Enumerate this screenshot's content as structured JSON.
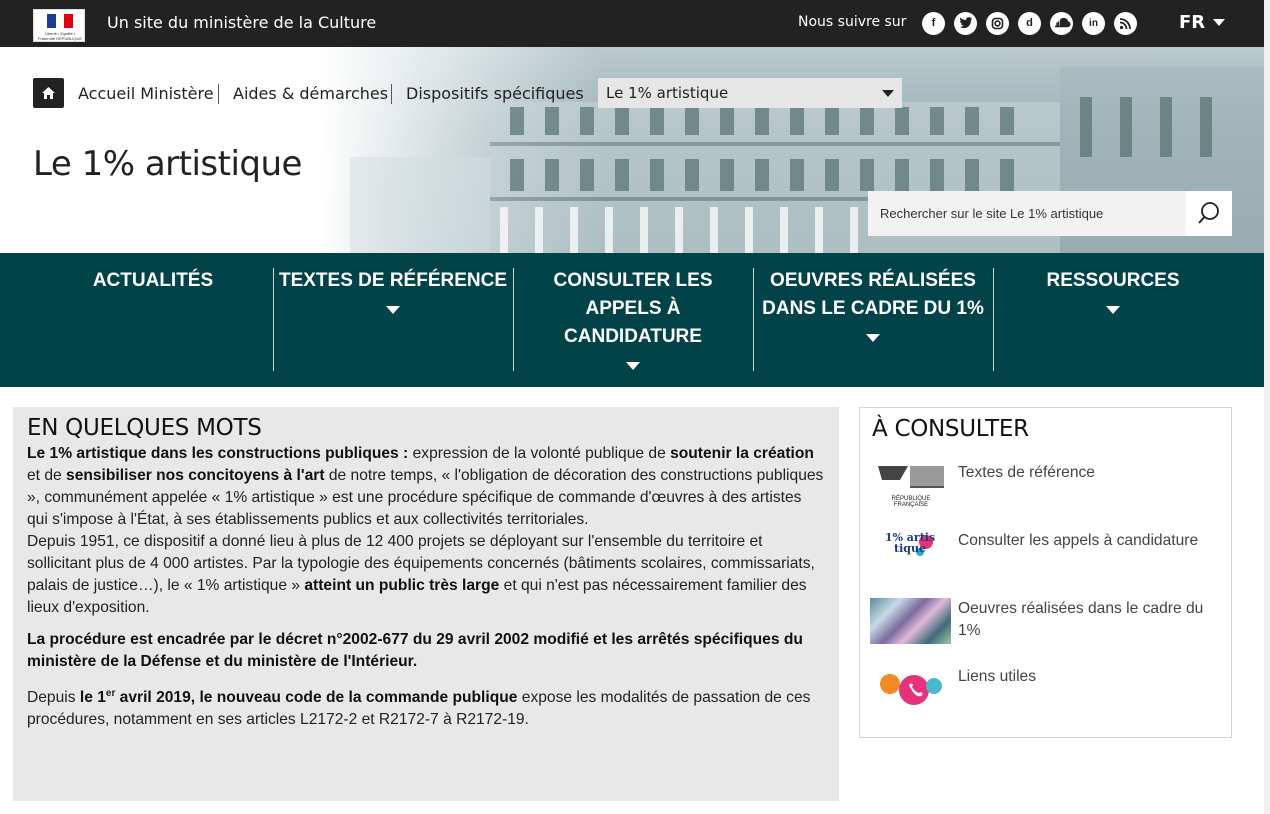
{
  "topbar": {
    "site_of": "Un site du ministère de la Culture",
    "follow": "Nous suivre sur",
    "social": [
      "facebook",
      "twitter",
      "instagram",
      "dailymotion",
      "soundcloud",
      "linkedin",
      "rss"
    ],
    "lang": "FR",
    "logo_text": "Liberté • Égalité • Fraternité RÉPUBLIQUE FRANÇAISE"
  },
  "breadcrumb": {
    "items": [
      "Accueil Ministère",
      "Aides & démarches",
      "Dispositifs spécifiques"
    ],
    "select_value": "Le 1% artistique"
  },
  "page_title": "Le 1% artistique",
  "search": {
    "placeholder": "Rechercher sur le site Le 1% artistique"
  },
  "nav": {
    "items": [
      "ACTUALITÉS",
      "TEXTES DE RÉFÉRENCE",
      "CONSULTER LES APPELS À CANDIDATURE",
      "OEUVRES RÉALISÉES DANS LE CADRE DU 1%",
      "RESSOURCES"
    ]
  },
  "intro": {
    "title": "EN QUELQUES MOTS",
    "p1_b1": "Le 1% artistique dans les constructions publiques :",
    "p1_t1": " expression de la volonté publique de ",
    "p1_b2": "soutenir la création",
    "p1_t2": " et de ",
    "p1_b3": "sensibiliser nos concitoyens à l'art",
    "p1_t3": " de notre temps, « l'obligation de décoration des constructions publiques », communément appelée « 1% artistique » est une procédure spécifique de commande d'œuvres à des artistes qui s'impose à l'État, à ses établissements publics et aux collectivités territoriales.",
    "p1_t4": "Depuis 1951, ce dispositif a donné lieu à plus de 12 400 projets se déployant sur l'ensemble du territoire et sollicitant plus de 4 000 artistes. Par la typologie des équipements concernés (bâtiments scolaires, commissariats, palais de justice…), le « 1% artistique » ",
    "p1_b4": "atteint un public très large",
    "p1_t5": " et qui n'est pas nécessairement familier des lieux d'exposition.",
    "p2": "La procédure est encadrée par le décret n°2002-677 du 29 avril 2002 modifié et les arrêtés spécifiques du ministère de la Défense et du ministère de l'Intérieur.",
    "p3_t1": "Depuis ",
    "p3_b1": "le 1",
    "p3_sup": "er",
    "p3_b2": " avril 2019, le nouveau code de la commande publique",
    "p3_t2": " expose les modalités de passation de ces procédures, notamment en ses articles L2172-2 et R2172-7 à R2172-19."
  },
  "aside": {
    "title": "À CONSULTER",
    "items": [
      {
        "label": "Textes de référence",
        "thumb_text": "RÉPUBLIQUE FRANÇAISE"
      },
      {
        "label": "Consulter les appels à candidature",
        "thumb_text": "1% artis tique"
      },
      {
        "label": "Oeuvres réalisées dans le cadre du 1%"
      },
      {
        "label": "Liens utiles"
      }
    ]
  },
  "colors": {
    "nav_bg": "#024349",
    "topbar_bg": "#222222",
    "intro_bg": "#e8e8e8"
  }
}
